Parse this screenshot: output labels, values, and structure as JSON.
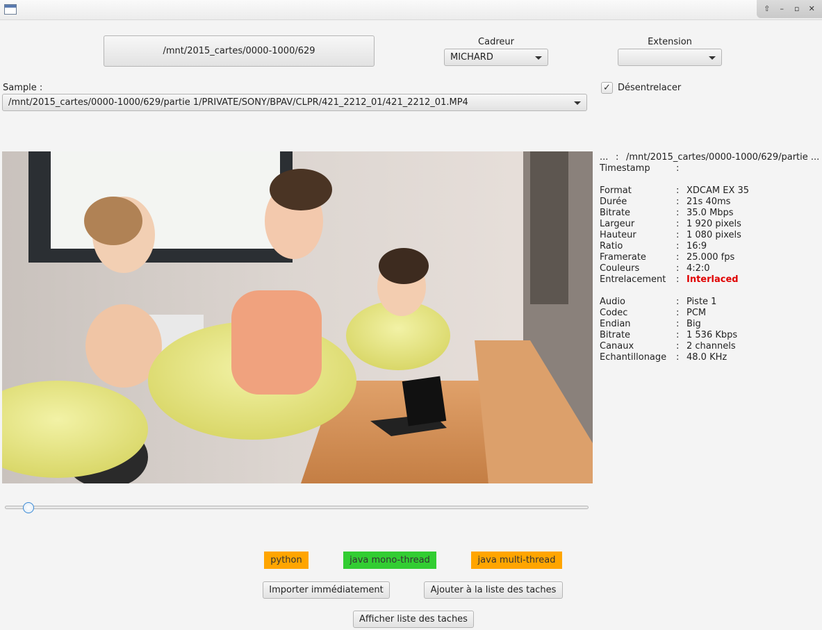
{
  "window": {
    "controls": [
      "⇧",
      "–",
      "▫",
      "✕"
    ]
  },
  "top": {
    "path_button": "/mnt/2015_cartes/0000-1000/629",
    "cadreur_label": "Cadreur",
    "cadreur_value": "MICHARD",
    "extension_label": "Extension",
    "extension_value": ""
  },
  "sample": {
    "label": "Sample :",
    "value": "/mnt/2015_cartes/0000-1000/629/partie 1/PRIVATE/SONY/BPAV/CLPR/421_2212_01/421_2212_01.MP4"
  },
  "deinterlace": {
    "label": "Désentrelacer",
    "checked": true
  },
  "info": {
    "rows_head": [
      {
        "k": "...",
        "v": "/mnt/2015_cartes/0000-1000/629/partie ..."
      },
      {
        "k": "Timestamp",
        "v": ""
      }
    ],
    "rows_video": [
      {
        "k": "Format",
        "v": "XDCAM EX 35"
      },
      {
        "k": "Durée",
        "v": "21s 40ms"
      },
      {
        "k": "Bitrate",
        "v": "35.0 Mbps"
      },
      {
        "k": "Largeur",
        "v": "1 920 pixels"
      },
      {
        "k": "Hauteur",
        "v": "1 080 pixels"
      },
      {
        "k": "Ratio",
        "v": "16:9"
      },
      {
        "k": "Framerate",
        "v": "25.000 fps"
      },
      {
        "k": "Couleurs",
        "v": "4:2:0"
      },
      {
        "k": "Entrelacement",
        "v": "Interlaced"
      }
    ],
    "rows_audio": [
      {
        "k": "Audio",
        "v": "Piste 1"
      },
      {
        "k": "Codec",
        "v": "PCM"
      },
      {
        "k": "Endian",
        "v": "Big"
      },
      {
        "k": "Bitrate",
        "v": "1 536 Kbps"
      },
      {
        "k": "Canaux",
        "v": "2 channels"
      },
      {
        "k": "Echantillonage",
        "v": "48.0 KHz"
      }
    ],
    "colon": ":"
  },
  "slider": {
    "position": 0.04
  },
  "engines": {
    "python": {
      "label": "python",
      "color": "#ffa500"
    },
    "mono": {
      "label": "java mono-thread",
      "color": "#32cd32"
    },
    "multi": {
      "label": "java multi-thread",
      "color": "#ffa500"
    }
  },
  "actions": {
    "import_now": "Importer immédiatement",
    "add_to_list": "Ajouter à la liste des taches",
    "show_list": "Afficher liste des taches"
  }
}
